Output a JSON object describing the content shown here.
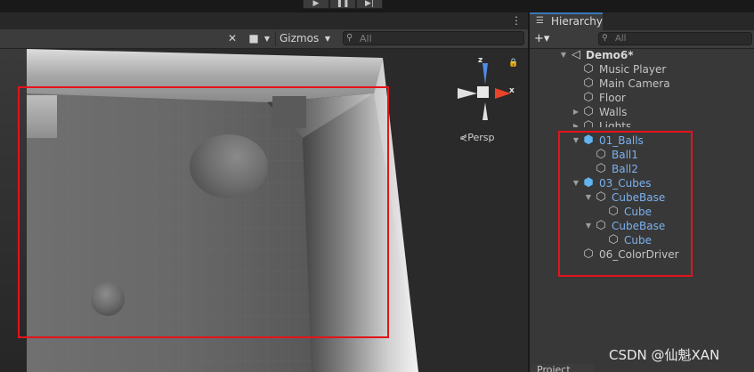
{
  "toolbar": {
    "play_icon": "play-icon",
    "pause_icon": "pause-icon",
    "step_icon": "step-icon",
    "play_glyph": "▶",
    "pause_glyph": "❚❚",
    "step_glyph": "▶|"
  },
  "scene_view": {
    "menu_glyph": "⋮",
    "tools_glyph": "✕",
    "camera_glyph": "■",
    "dropdown_glyph": "▼",
    "gizmos_label": "Gizmos",
    "search_placeholder": "All",
    "search_glyph": "⚲",
    "gizmo": {
      "z_label": "z",
      "x_label": "x",
      "lock_glyph": "🔒",
      "projection_label": "Persp",
      "projection_glyph": "⋞",
      "axis_colors": {
        "y": "#4f8be8",
        "x": "#e8442a",
        "other": "#e0e0e0"
      }
    }
  },
  "hierarchy": {
    "title": "Hierarchy",
    "tab_glyph": "☰",
    "add_glyph": "+▾",
    "search_placeholder": "All",
    "search_glyph": "⚲",
    "scene_name": "Demo6*",
    "scene_glyph": "◁",
    "items": [
      {
        "label": "Music Player"
      },
      {
        "label": "Main Camera"
      },
      {
        "label": "Floor"
      },
      {
        "label": "Walls"
      },
      {
        "label": "Lights"
      },
      {
        "label": "01_Balls"
      },
      {
        "label": "Ball1"
      },
      {
        "label": "Ball2"
      },
      {
        "label": "03_Cubes"
      },
      {
        "label": "CubeBase"
      },
      {
        "label": "Cube"
      },
      {
        "label": "CubeBase"
      },
      {
        "label": "Cube"
      },
      {
        "label": "06_ColorDriver"
      }
    ],
    "colors": {
      "prefab_text": "#7cb1ee",
      "prefab_icon": "#62b4f0",
      "highlight": "#e5131b"
    }
  },
  "project_tab": {
    "label": "Project"
  },
  "watermark": {
    "text": "CSDN @仙魁XAN"
  }
}
